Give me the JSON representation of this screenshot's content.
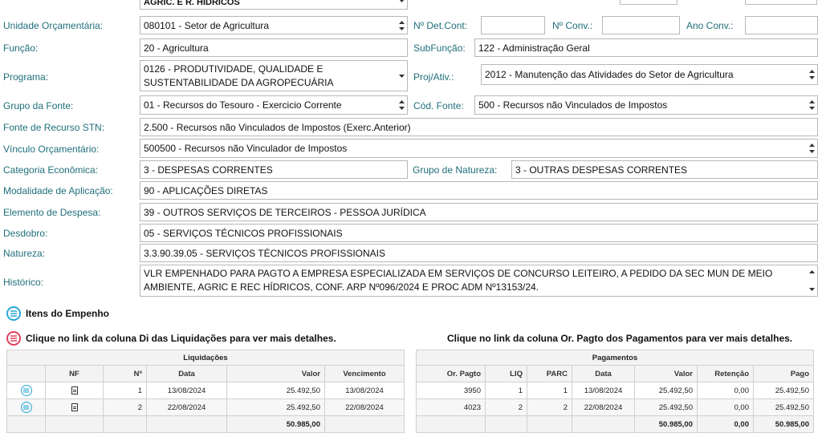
{
  "form": {
    "top_partial": {
      "value": "AGRIC. E R. HÍDRICOS"
    },
    "unidade": {
      "label": "Unidade Orçamentária:",
      "value": "080101 - Setor de Agricultura"
    },
    "det_cont": {
      "label": "Nº Det.Cont:",
      "value": ""
    },
    "conv": {
      "label": "Nº Conv.:",
      "value": ""
    },
    "ano_conv": {
      "label": "Ano Conv.:",
      "value": ""
    },
    "funcao": {
      "label": "Função:",
      "value": "20 - Agricultura"
    },
    "subfuncao": {
      "label": "SubFunção:",
      "value": "122 - Administração Geral"
    },
    "programa": {
      "label": "Programa:",
      "value": "0126 - PRODUTIVIDADE, QUALIDADE E SUSTENTABILIDADE DA AGROPECUÁRIA"
    },
    "proj_ativ": {
      "label": "Proj/Ativ.:",
      "value": "2012 - Manutenção das Atividades do Setor de Agricultura"
    },
    "grupo_fonte": {
      "label": "Grupo da Fonte:",
      "value": "01 - Recursos do Tesouro - Exercicio Corrente"
    },
    "cod_fonte": {
      "label": "Cód. Fonte:",
      "value": "500 - Recursos não Vinculados de Impostos"
    },
    "fonte_stn": {
      "label": "Fonte de Recurso STN:",
      "value": "2.500 - Recursos não Vinculados de Impostos (Exerc.Anterior)"
    },
    "vinculo": {
      "label": "Vínculo Orçamentário:",
      "value": "500500 - Recursos não Vinculador de Impostos"
    },
    "categoria": {
      "label": "Categoria Econômica:",
      "value": "3 - DESPESAS CORRENTES"
    },
    "grupo_natureza": {
      "label": "Grupo de Natureza:",
      "value": "3 - OUTRAS DESPESAS CORRENTES"
    },
    "modalidade": {
      "label": "Modalidade de Aplicação:",
      "value": "90 - APLICAÇÕES DIRETAS"
    },
    "elemento": {
      "label": "Elemento de Despesa:",
      "value": "39 - OUTROS SERVIÇOS DE TERCEIROS - PESSOA JURÍDICA"
    },
    "desdobro": {
      "label": "Desdobro:",
      "value": "05 - SERVIÇOS TÉCNICOS PROFISSIONAIS"
    },
    "natureza": {
      "label": "Natureza:",
      "value": "3.3.90.39.05 - SERVIÇOS TÉCNICOS PROFISSIONAIS"
    },
    "historico": {
      "label": "Histórico:",
      "value": "VLR EMPENHADO PARA PAGTO A EMPRESA ESPECIALIZADA EM SERVIÇOS DE CONCURSO LEITEIRO, A PEDIDO DA SEC MUN DE MEIO AMBIENTE, AGRIC E REC HÍDRICOS, CONF. ARP Nº096/2024 E PROC ADM Nº13153/24."
    }
  },
  "sections": {
    "itens": "Itens do Empenho",
    "liq_hint": "Clique no link da coluna Di das Liquidações para ver mais detalhes.",
    "pag_hint": "Clique no link da coluna Or. Pagto dos Pagamentos para ver mais detalhes."
  },
  "liquidacoes": {
    "caption": "Liquidações",
    "headers": [
      "",
      "NF",
      "Nº",
      "Data",
      "Valor",
      "Vencimento"
    ],
    "rows": [
      {
        "num": "1",
        "data": "13/08/2024",
        "valor": "25.492,50",
        "venc": "13/08/2024"
      },
      {
        "num": "2",
        "data": "22/08/2024",
        "valor": "25.492,50",
        "venc": "22/08/2024"
      }
    ],
    "total": "50.985,00"
  },
  "pagamentos": {
    "caption": "Pagamentos",
    "headers": [
      "Or. Pagto",
      "LIQ",
      "PARC",
      "Data",
      "Valor",
      "Retenção",
      "Pago"
    ],
    "rows": [
      {
        "or": "3950",
        "liq": "1",
        "parc": "1",
        "data": "13/08/2024",
        "valor": "25.492,50",
        "ret": "0,00",
        "pago": "25.492,50"
      },
      {
        "or": "4023",
        "liq": "2",
        "parc": "2",
        "data": "22/08/2024",
        "valor": "25.492,50",
        "ret": "0,00",
        "pago": "25.492,50"
      }
    ],
    "total": {
      "valor": "50.985,00",
      "ret": "0,00",
      "pago": "50.985,00"
    }
  },
  "colors": {
    "label": "#1f6f7a",
    "accent_blue": "#2aa8d8",
    "accent_red": "#e0405a"
  }
}
